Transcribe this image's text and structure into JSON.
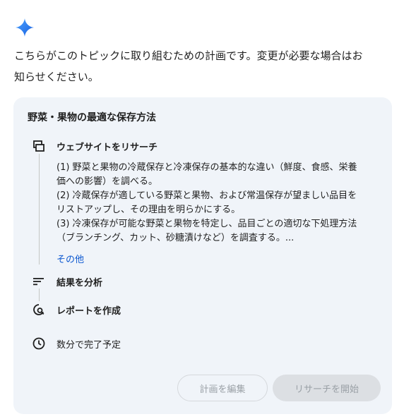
{
  "intro": {
    "line1": "こちらがこのトピックに取り組むための計画です。変更が必要な場合はお",
    "line2": "知らせください。"
  },
  "plan": {
    "title": "野菜・果物の最適な保存方法",
    "steps": [
      {
        "icon": "web-search-icon",
        "label": "ウェブサイトをリサーチ",
        "details": [
          "(1) 野菜と果物の冷蔵保存と冷凍保存の基本的な違い（鮮度、食感、栄養",
          "価への影響）を調べる。",
          "(2) 冷蔵保存が適している野菜と果物、および常温保存が望ましい品目を",
          "リストアップし、その理由を明らかにする。",
          "(3) 冷凍保存が可能な野菜と果物を特定し、品目ごとの適切な下処理方法",
          "（ブランチング、カット、砂糖漬けなど）を調査する。..."
        ],
        "more_label": "その他"
      },
      {
        "icon": "analyze-results-icon",
        "label": "結果を分析"
      },
      {
        "icon": "report-icon",
        "label": "レポートを作成"
      }
    ],
    "eta_icon": "clock-icon",
    "eta": "数分で完了予定"
  },
  "buttons": {
    "edit_label": "計画を編集",
    "start_label": "リサーチを開始"
  },
  "colors": {
    "card_bg": "#f0f4f9",
    "link": "#0b57d0",
    "spark_gradient": [
      "#4285f4",
      "#1a73e8"
    ]
  }
}
